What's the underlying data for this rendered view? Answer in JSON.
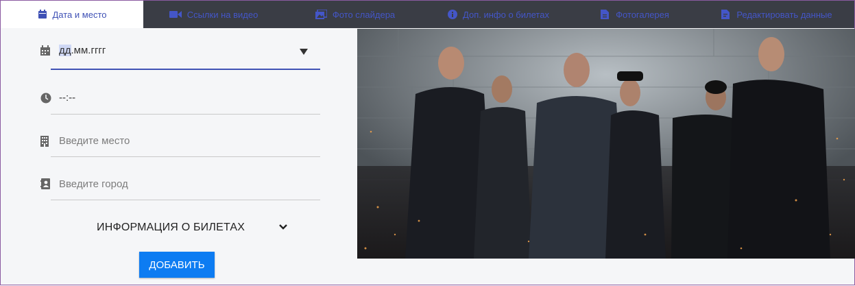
{
  "tabs": [
    {
      "label": "Дата и место",
      "icon": "calendar-icon",
      "active": true
    },
    {
      "label": "Ссылки на видео",
      "icon": "video-camera-icon",
      "active": false
    },
    {
      "label": "Фото слайдера",
      "icon": "image-gallery-icon",
      "active": false
    },
    {
      "label": "Доп. инфо о билетах",
      "icon": "info-icon",
      "active": false
    },
    {
      "label": "Фотогалерея",
      "icon": "file-icon",
      "active": false
    },
    {
      "label": "Редактировать данные",
      "icon": "file-edit-icon",
      "active": false
    }
  ],
  "form": {
    "date": {
      "seg_day": "дд",
      "rest": ".мм.гггг",
      "icon": "calendar-icon"
    },
    "time": {
      "value": "--:--",
      "icon": "clock-icon"
    },
    "place": {
      "placeholder": "Введите место",
      "icon": "building-icon"
    },
    "city": {
      "placeholder": "Введите город",
      "icon": "contact-book-icon"
    },
    "tickets_label": "ИНФОРМАЦИЯ О БИЛЕТАХ",
    "add_label": "ДОБАВИТЬ"
  },
  "colors": {
    "tab_bar": "#3a3d45",
    "tab_text": "#4456c8",
    "accent": "#3f51b5",
    "button": "#0d7cf2"
  }
}
